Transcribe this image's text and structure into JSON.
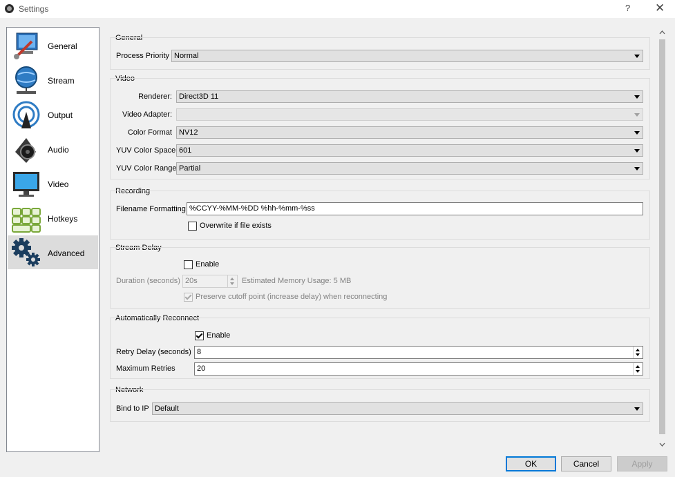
{
  "window": {
    "title": "Settings",
    "help_label": "?",
    "close_label": "✕"
  },
  "sidebar": {
    "items": [
      {
        "label": "General",
        "icon": "general-icon"
      },
      {
        "label": "Stream",
        "icon": "stream-icon"
      },
      {
        "label": "Output",
        "icon": "output-icon"
      },
      {
        "label": "Audio",
        "icon": "audio-icon"
      },
      {
        "label": "Video",
        "icon": "video-icon"
      },
      {
        "label": "Hotkeys",
        "icon": "hotkeys-icon"
      },
      {
        "label": "Advanced",
        "icon": "advanced-icon"
      }
    ],
    "selected": "Advanced"
  },
  "general": {
    "title": "General",
    "process_priority_label": "Process Priority",
    "process_priority_value": "Normal"
  },
  "video": {
    "title": "Video",
    "renderer_label": "Renderer:",
    "renderer_value": "Direct3D 11",
    "adapter_label": "Video Adapter:",
    "adapter_value": "",
    "color_format_label": "Color Format",
    "color_format_value": "NV12",
    "color_space_label": "YUV Color Space",
    "color_space_value": "601",
    "color_range_label": "YUV Color Range",
    "color_range_value": "Partial"
  },
  "recording": {
    "title": "Recording",
    "filename_label": "Filename Formatting",
    "filename_value": "%CCYY-%MM-%DD %hh-%mm-%ss",
    "overwrite_label": "Overwrite if file exists",
    "overwrite_checked": false
  },
  "stream_delay": {
    "title": "Stream Delay",
    "enable_label": "Enable",
    "enable_checked": false,
    "duration_label": "Duration (seconds)",
    "duration_value": "20s",
    "memory_label": "Estimated Memory Usage: 5 MB",
    "preserve_label": "Preserve cutoff point (increase delay) when reconnecting",
    "preserve_checked": true
  },
  "reconnect": {
    "title": "Automatically Reconnect",
    "enable_label": "Enable",
    "enable_checked": true,
    "retry_delay_label": "Retry Delay (seconds)",
    "retry_delay_value": "8",
    "max_retries_label": "Maximum Retries",
    "max_retries_value": "20"
  },
  "network": {
    "title": "Network",
    "bind_label": "Bind to IP",
    "bind_value": "Default"
  },
  "buttons": {
    "ok": "OK",
    "cancel": "Cancel",
    "apply": "Apply"
  },
  "colors": {
    "accent": "#0078d7",
    "selected_bg": "#dcdcdc",
    "window_bg": "#f0f0f0"
  }
}
